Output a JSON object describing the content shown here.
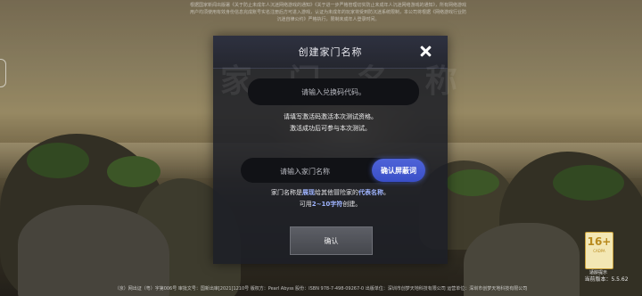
{
  "background": {
    "notice_lines": [
      "根据国家新闻出版署《关于防止未成年人沉迷网络游戏的通知》《关于进一步严格管理切实防止未成年人沉迷网络游戏的通知》，所有网络游戏",
      "用户均须使用有效身份信息完成账号实名注册后方可进入游戏，认证为未成年的玩家将受到防沉迷系统限制，本公司将根据《网络游戏行业防",
      "沉迷自律公约》严格执行，限制未成年人登录时间。"
    ],
    "watermark": "家 门 名 称"
  },
  "dialog": {
    "title": "创建家门名称",
    "code_placeholder": "请输入兑换码代码。",
    "hint1_line1": "请填写激活码激活本次测试资格。",
    "hint1_line2": "激活成功后可参与本次测试。",
    "family_placeholder": "请输入家门名称",
    "check_button": "确认屏蔽词",
    "hint2_pre": "家门名称是",
    "hint2_hl1": "展现",
    "hint2_mid": "给其他冒险家的",
    "hint2_hl2": "代表名称",
    "hint2_post": "。",
    "hint2_line2_pre": "可用",
    "hint2_line2_hl": "2~10字符",
    "hint2_line2_post": "创建。",
    "confirm_button": "确认"
  },
  "age_rating": {
    "number": "16+",
    "sub": "CADPA",
    "label": "适龄提示"
  },
  "version": "当前版本：5.5.62",
  "footer": "（京）网出证（粤）字第006号 审批文号：国新出审[2021]1210号 版权方：Pearl Abyss 股份：ISBN 978-7-498-09267-0 出版单位：深圳市创梦天地科技有限公司 运营单位：深圳市创梦天地科技有限公司"
}
